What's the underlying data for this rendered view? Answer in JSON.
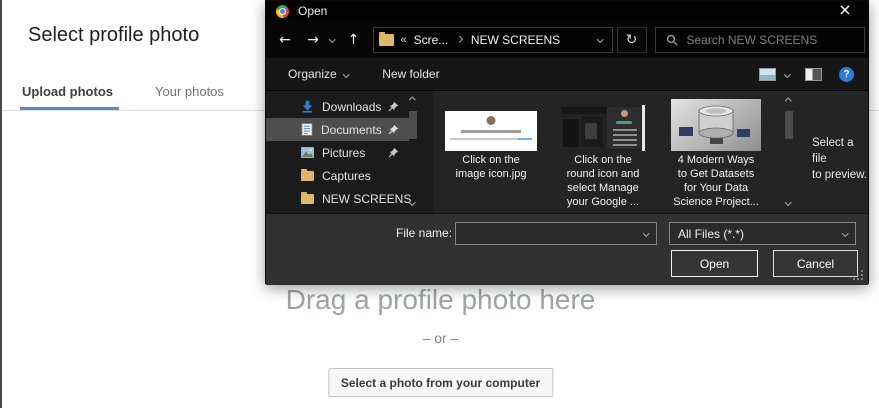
{
  "page": {
    "title": "Select profile photo",
    "tabs": {
      "upload": "Upload photos",
      "your": "Your photos"
    },
    "drop_area": {
      "drag_text": "Drag a profile photo here",
      "or_text": "– or –",
      "select_button": "Select a photo from your computer"
    },
    "accent_color": "#5b87c8"
  },
  "dialog": {
    "title": "Open",
    "icons": {
      "close": "×",
      "back": "←",
      "forward": "→",
      "up": "↑",
      "refresh": "↻",
      "overflow": "«",
      "help": "?",
      "organize_app": "chrome"
    },
    "navbar": {
      "crumb_parent": "Scre...",
      "crumb_current": "NEW SCREENS",
      "search_placeholder": "Search NEW SCREENS"
    },
    "toolbar": {
      "organize": "Organize",
      "new_folder": "New folder"
    },
    "sidebar": {
      "items": [
        {
          "label": "Downloads",
          "icon": "downloads-icon",
          "pinned": true,
          "selected": false
        },
        {
          "label": "Documents",
          "icon": "documents-icon",
          "pinned": true,
          "selected": true
        },
        {
          "label": "Pictures",
          "icon": "pictures-icon",
          "pinned": true,
          "selected": false
        },
        {
          "label": "Captures",
          "icon": "folder-icon",
          "pinned": false,
          "selected": false
        },
        {
          "label": "NEW SCREENS",
          "icon": "folder-icon",
          "pinned": false,
          "selected": false
        }
      ]
    },
    "files": [
      {
        "caption": "Click on the\nimage icon.jpg",
        "thumb": "white-page-screenshot"
      },
      {
        "caption": "Click on the\nround icon and\nselect Manage\nyour Google ...",
        "thumb": "dark-ui-screenshot"
      },
      {
        "caption": "4 Modern Ways\nto Get Datasets\nfor Your Data\nScience Project...",
        "thumb": "database-3d-image"
      }
    ],
    "preview_hint": "Select a file\nto preview.",
    "footer": {
      "file_name_label": "File name:",
      "file_name_value": "",
      "file_type_value": "All Files (*.*)",
      "open_label": "Open",
      "cancel_label": "Cancel"
    },
    "colors": {
      "titlebar_bg": "#030303",
      "body_bg": "#242424",
      "sidebar_bg": "#1b1b1b",
      "footer_bg": "#313131",
      "selection_gray": "#4e4e4e",
      "folder_yellow": "#dcb868",
      "help_blue": "#2e7cd6",
      "downloads_blue": "#2e7ed2"
    }
  }
}
